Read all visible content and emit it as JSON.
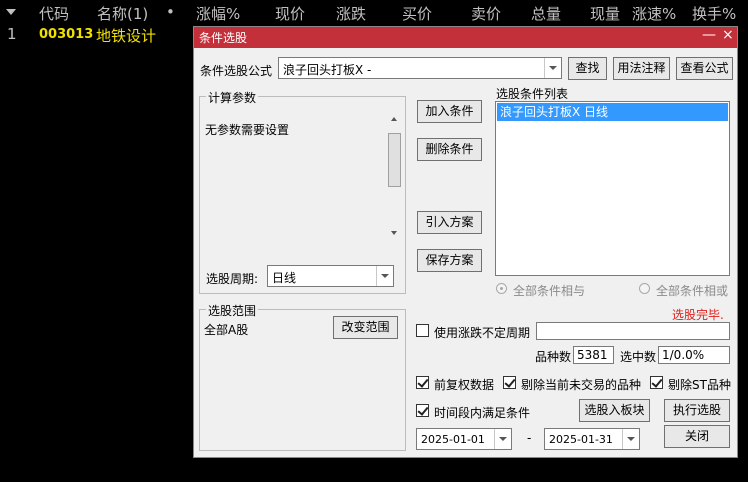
{
  "stock_list": {
    "columns": [
      "代码",
      "名称(1)",
      "•",
      "涨幅%",
      "现价",
      "涨跌",
      "买价",
      "卖价",
      "总量",
      "现量",
      "涨速%",
      "换手%"
    ],
    "row": {
      "index": "1",
      "code": "003013",
      "name": "地铁设计"
    }
  },
  "dialog": {
    "title": "条件选股",
    "minimize_glyph": "—",
    "close_glyph": "×",
    "formula_label": "条件选股公式",
    "formula_value": "浪子回头打板X -",
    "find_button": "查找",
    "usage_button": "用法注释",
    "view_formula_button": "查看公式",
    "params_group_title": "计算参数",
    "params_text": "无参数需要设置",
    "period_label": "选股周期:",
    "period_value": "日线",
    "add_condition_button": "加入条件",
    "delete_condition_button": "删除条件",
    "import_plan_button": "引入方案",
    "save_plan_button": "保存方案",
    "condition_list_label": "选股条件列表",
    "condition_items": [
      "浪子回头打板X  日线"
    ],
    "radio_and_label": "全部条件相与",
    "radio_or_label": "全部条件相或",
    "status_text": "选股完毕.",
    "range_group_title": "选股范围",
    "range_value": "全部A股",
    "change_range_button": "改变范围",
    "variable_period_label": "使用涨跌不定周期",
    "variable_period_value": "",
    "count_label": "品种数",
    "count_value": "5381",
    "selected_label": "选中数",
    "selected_value": "1/0.0%",
    "pre_adjust_label": "前复权数据",
    "exclude_untraded_label": "剔除当前未交易的品种",
    "exclude_st_label": "剔除ST品种",
    "time_range_label": "时间段内满足条件",
    "to_block_button": "选股入板块",
    "execute_button": "执行选股",
    "date_from": "2025-01-01",
    "date_sep": "-",
    "date_to": "2025-01-31",
    "close_button": "关闭"
  },
  "colors": {
    "title_bar": "#c4303a",
    "status_text": "#e0201c",
    "code_text": "#f0e000",
    "name_text": "#f0e000",
    "selection": "#3399ff"
  }
}
